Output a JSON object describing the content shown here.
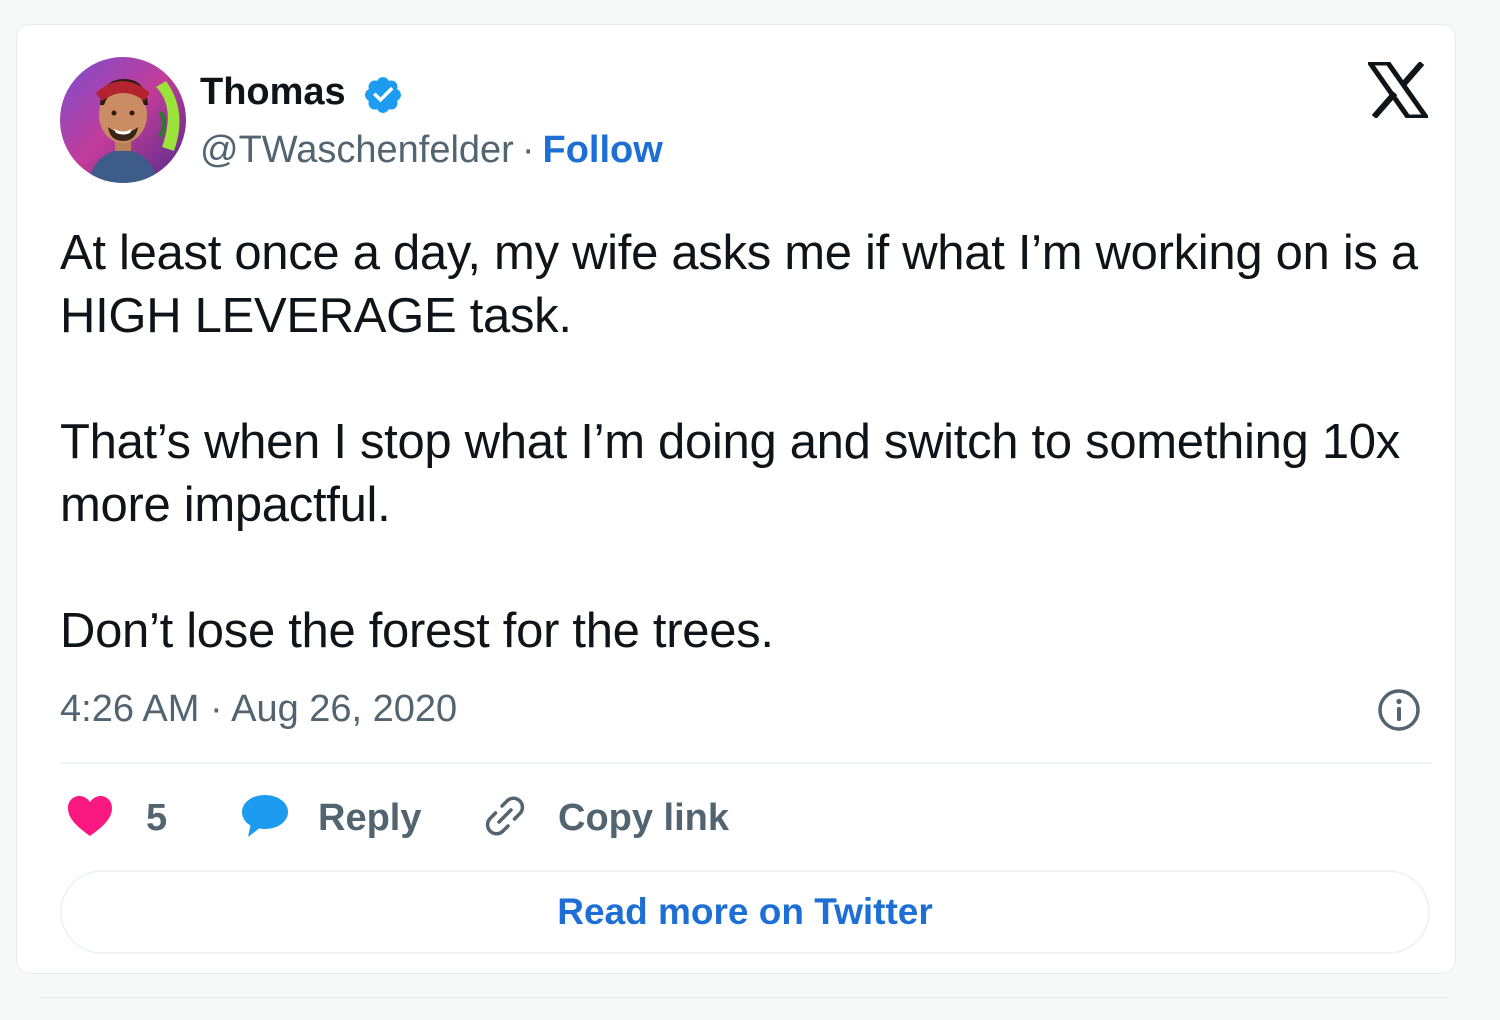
{
  "author": {
    "name": "Thomas",
    "handle": "@TWaschenfelder",
    "separator": "·",
    "follow_label": "Follow",
    "verified_icon": "verified-badge-icon",
    "verified_color": "#1d9bf0"
  },
  "brand": {
    "logo_icon": "x-logo-icon"
  },
  "tweet": {
    "paragraphs": [
      "At least once a day, my wife asks me if what I’m working on is a HIGH LEVERAGE task.",
      "That’s when I stop what I’m doing and switch to something 10x more impactful.",
      "Don’t lose the forest for the trees."
    ],
    "timestamp": "4:26 AM · Aug 26, 2020",
    "info_icon": "info-icon"
  },
  "actions": {
    "like_count": "5",
    "like_icon": "heart-icon",
    "like_color": "#f91880",
    "reply_label": "Reply",
    "reply_icon": "reply-bubble-icon",
    "reply_color": "#1d9bf0",
    "copy_label": "Copy link",
    "copy_icon": "link-icon"
  },
  "footer": {
    "read_more_label": "Read more on Twitter"
  },
  "colors": {
    "accent": "#1d6fd6",
    "text_primary": "#0f1419",
    "text_secondary": "#536471"
  }
}
